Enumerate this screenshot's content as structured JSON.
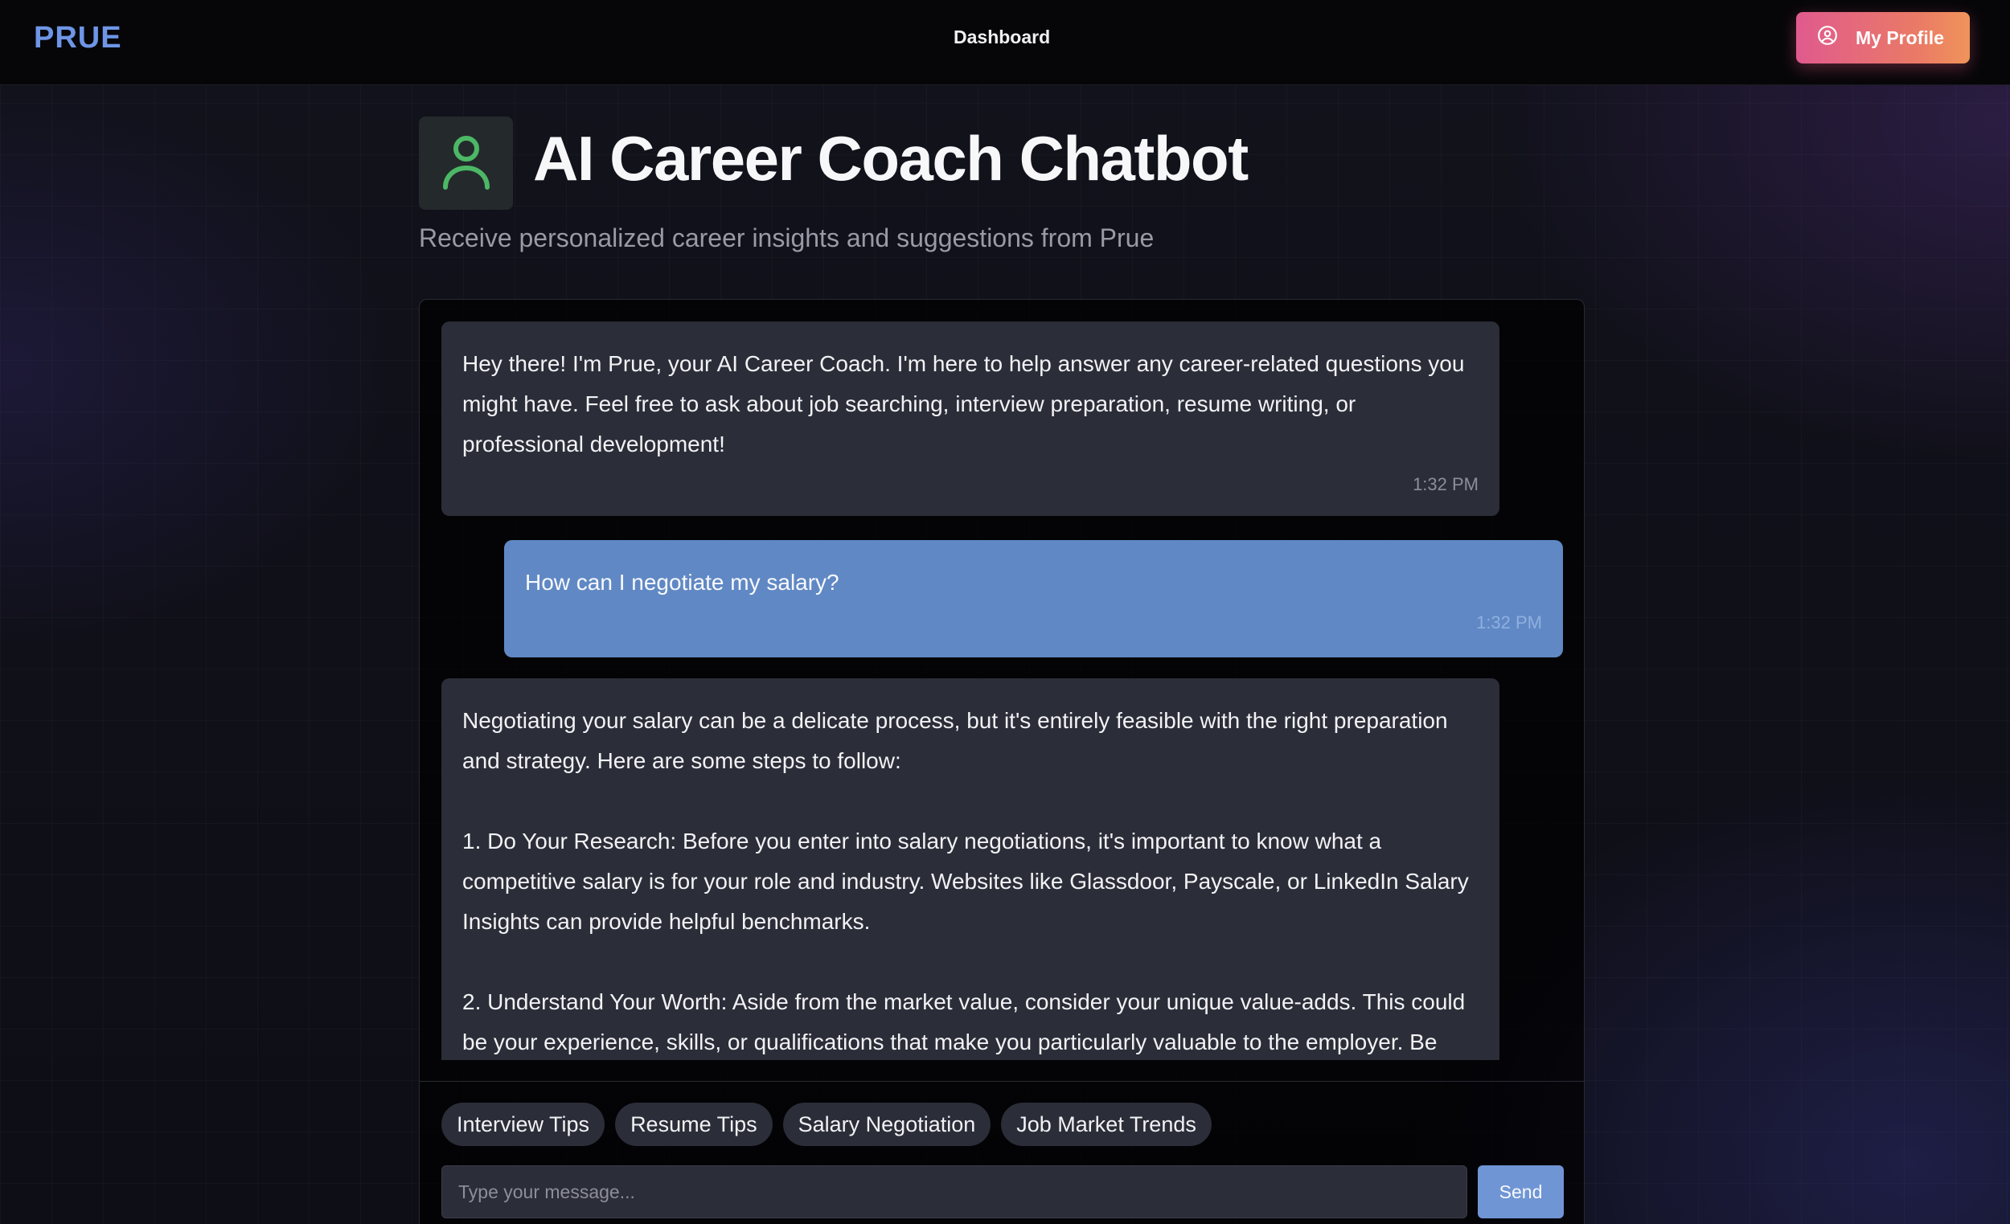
{
  "nav": {
    "logo": "PRUE",
    "dashboard_label": "Dashboard",
    "profile_label": "My Profile",
    "profile_icon": "user-circle-icon"
  },
  "header": {
    "icon": "user-icon",
    "title": "AI Career Coach Chatbot",
    "subtitle": "Receive personalized career insights and suggestions from Prue"
  },
  "messages": [
    {
      "sender": "bot",
      "text": "Hey there! I'm Prue, your AI Career Coach. I'm here to help answer any career-related questions you might have. Feel free to ask about job searching, interview preparation, resume writing, or professional development!",
      "time": "1:32 PM"
    },
    {
      "sender": "user",
      "text": "How can I negotiate my salary?",
      "time": "1:32 PM"
    },
    {
      "sender": "bot",
      "text": "Negotiating your salary can be a delicate process, but it's entirely feasible with the right preparation and strategy. Here are some steps to follow:\n\n1. Do Your Research: Before you enter into salary negotiations, it's important to know what a competitive salary is for your role and industry. Websites like Glassdoor, Payscale, or LinkedIn Salary Insights can provide helpful benchmarks.\n\n2. Understand Your Worth: Aside from the market value, consider your unique value-adds. This could be your experience, skills, or qualifications that make you particularly valuable to the employer. Be",
      "time": ""
    }
  ],
  "quick_replies": [
    "Interview Tips",
    "Resume Tips",
    "Salary Negotiation",
    "Job Market Trends"
  ],
  "composer": {
    "placeholder": "Type your message...",
    "value": "",
    "send_label": "Send"
  },
  "colors": {
    "logo": "#6e95e6",
    "user_bubble": "#6088c4",
    "bot_bubble": "#2b2d38",
    "send_button": "#6f95d4",
    "profile_gradient_start": "#e05a8e",
    "profile_gradient_end": "#f0945a",
    "header_icon": "#4cb866"
  }
}
